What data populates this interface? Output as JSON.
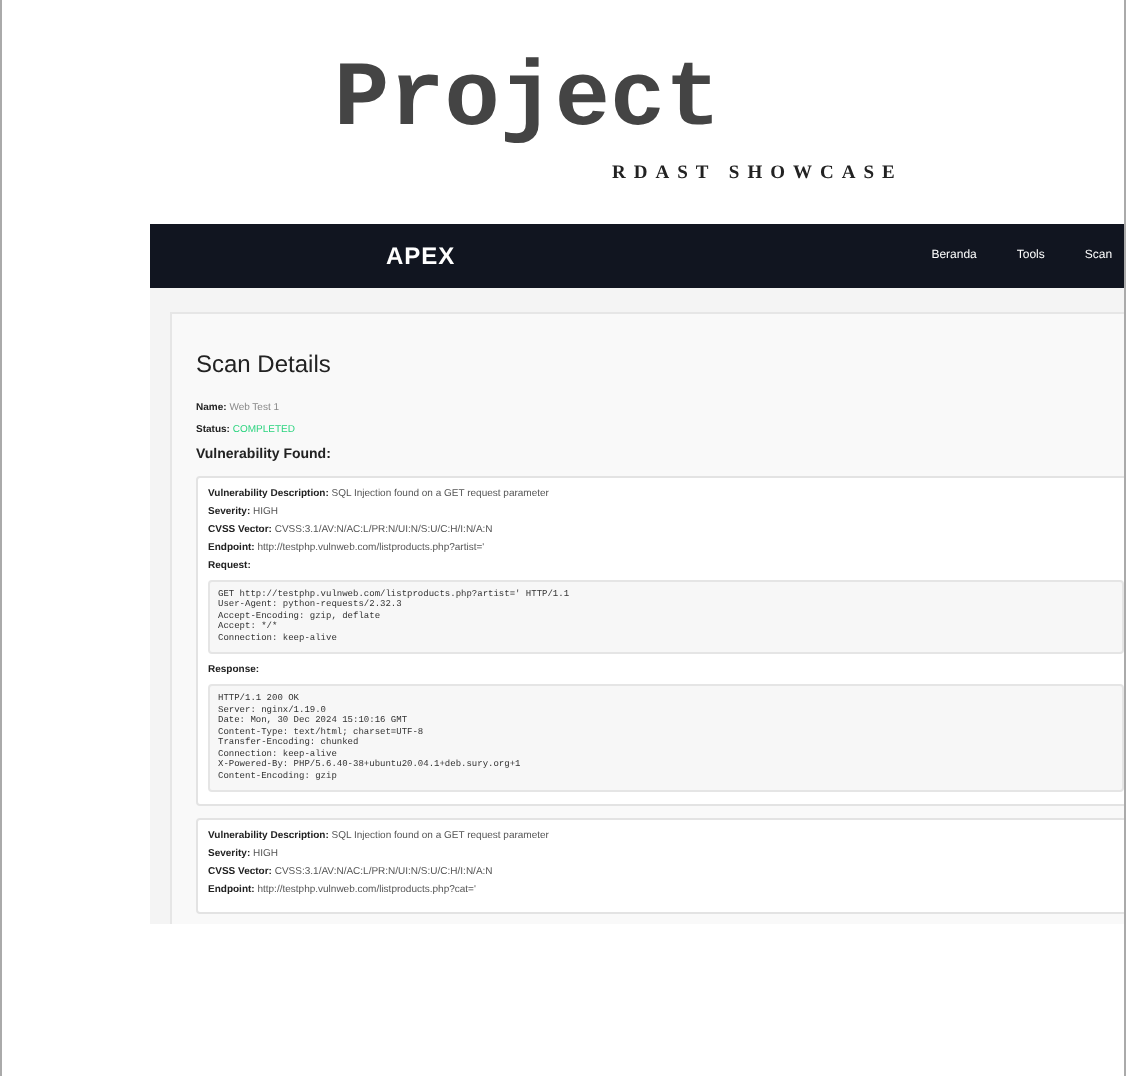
{
  "slide": {
    "title": "Project",
    "subtitle": "RDAST SHOWCASE"
  },
  "app": {
    "logo": "APEX",
    "nav": [
      "Beranda",
      "Tools",
      "Scan"
    ],
    "heading": "Scan Details",
    "info": [
      {
        "label": "Name:",
        "value": "Web Test 1",
        "kind": "plain"
      },
      {
        "label": "Status:",
        "value": "COMPLETED",
        "kind": "success"
      }
    ],
    "section_label": "Vulnerability Found:",
    "findings": [
      {
        "fields": [
          {
            "label": "Vulnerability Description:",
            "value": "SQL Injection found on a GET request parameter"
          },
          {
            "label": "Severity:",
            "value": "HIGH"
          },
          {
            "label": "CVSS Vector:",
            "value": "CVSS:3.1/AV:N/AC:L/PR:N/UI:N/S:U/C:H/I:N/A:N"
          },
          {
            "label": "Endpoint:",
            "value": "http://testphp.vulnweb.com/listproducts.php?artist='"
          }
        ],
        "request_label": "Request:",
        "request": [
          "GET http://testphp.vulnweb.com/listproducts.php?artist=' HTTP/1.1",
          "User-Agent: python-requests/2.32.3",
          "Accept-Encoding: gzip, deflate",
          "Accept: */*",
          "Connection: keep-alive"
        ],
        "response_label": "Response:",
        "response": [
          "HTTP/1.1 200 OK",
          "Server: nginx/1.19.0",
          "Date: Mon, 30 Dec 2024 15:10:16 GMT",
          "Content-Type: text/html; charset=UTF-8",
          "Transfer-Encoding: chunked",
          "Connection: keep-alive",
          "X-Powered-By: PHP/5.6.40-38+ubuntu20.04.1+deb.sury.org+1",
          "Content-Encoding: gzip"
        ]
      },
      {
        "fields": [
          {
            "label": "Vulnerability Description:",
            "value": "SQL Injection found on a GET request parameter"
          },
          {
            "label": "Severity:",
            "value": "HIGH"
          },
          {
            "label": "CVSS Vector:",
            "value": "CVSS:3.1/AV:N/AC:L/PR:N/UI:N/S:U/C:H/I:N/A:N"
          },
          {
            "label": "Endpoint:",
            "value": "http://testphp.vulnweb.com/listproducts.php?cat='"
          }
        ]
      }
    ]
  }
}
